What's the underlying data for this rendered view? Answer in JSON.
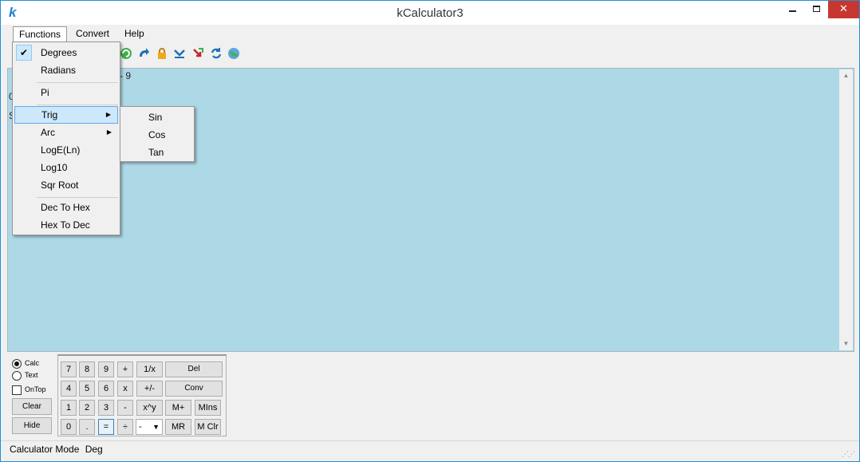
{
  "window": {
    "title": "kCalculator3",
    "app_icon": "k",
    "minimize": "—",
    "close": "✕"
  },
  "menubar": {
    "functions": "Functions",
    "convert": "Convert",
    "help": "Help"
  },
  "toolbar": [
    "undo-icon",
    "redo-icon",
    "lock-icon",
    "down-icon",
    "arrows-icon",
    "refresh-icon",
    "globe-icon"
  ],
  "display": {
    "fragments": [
      "- 9",
      "0",
      "S"
    ]
  },
  "functions_menu": {
    "items": {
      "degrees": "Degrees",
      "radians": "Radians",
      "pi": "Pi",
      "trig": "Trig",
      "arc": "Arc",
      "loge": "LogE(Ln)",
      "log10": "Log10",
      "sqr_root": "Sqr Root",
      "dec_to_hex": "Dec To Hex",
      "hex_to_dec": "Hex To Dec"
    },
    "checked": "degrees",
    "highlighted": "trig",
    "check": "✔",
    "submenu_arrow": "▶"
  },
  "trig_submenu": {
    "sin": "Sin",
    "cos": "Cos",
    "tan": "Tan"
  },
  "mode_panel": {
    "calc": "Calc",
    "text": "Text",
    "ontop": "OnTop",
    "clear": "Clear",
    "hide": "Hide",
    "selected_mode": "calc"
  },
  "keypad": {
    "row1": [
      "7",
      "8",
      "9",
      "+",
      "1/x"
    ],
    "row2": [
      "4",
      "5",
      "6",
      "x",
      "+/-"
    ],
    "row3": [
      "1",
      "2",
      "3",
      "-",
      "x^y"
    ],
    "row4": [
      "0",
      ".",
      "=",
      "÷"
    ],
    "op_select": "-",
    "del": "Del",
    "conv": "Conv",
    "mplus": "M+",
    "mins": "MIns",
    "mr": "MR",
    "mclr": "M Clr"
  },
  "statusbar": {
    "mode": "Calculator Mode",
    "unit": "Deg"
  },
  "colors": {
    "display_bg": "#add8e6",
    "highlight": "#cde8fb",
    "accent": "#1e8fd8",
    "close": "#c7372f"
  }
}
